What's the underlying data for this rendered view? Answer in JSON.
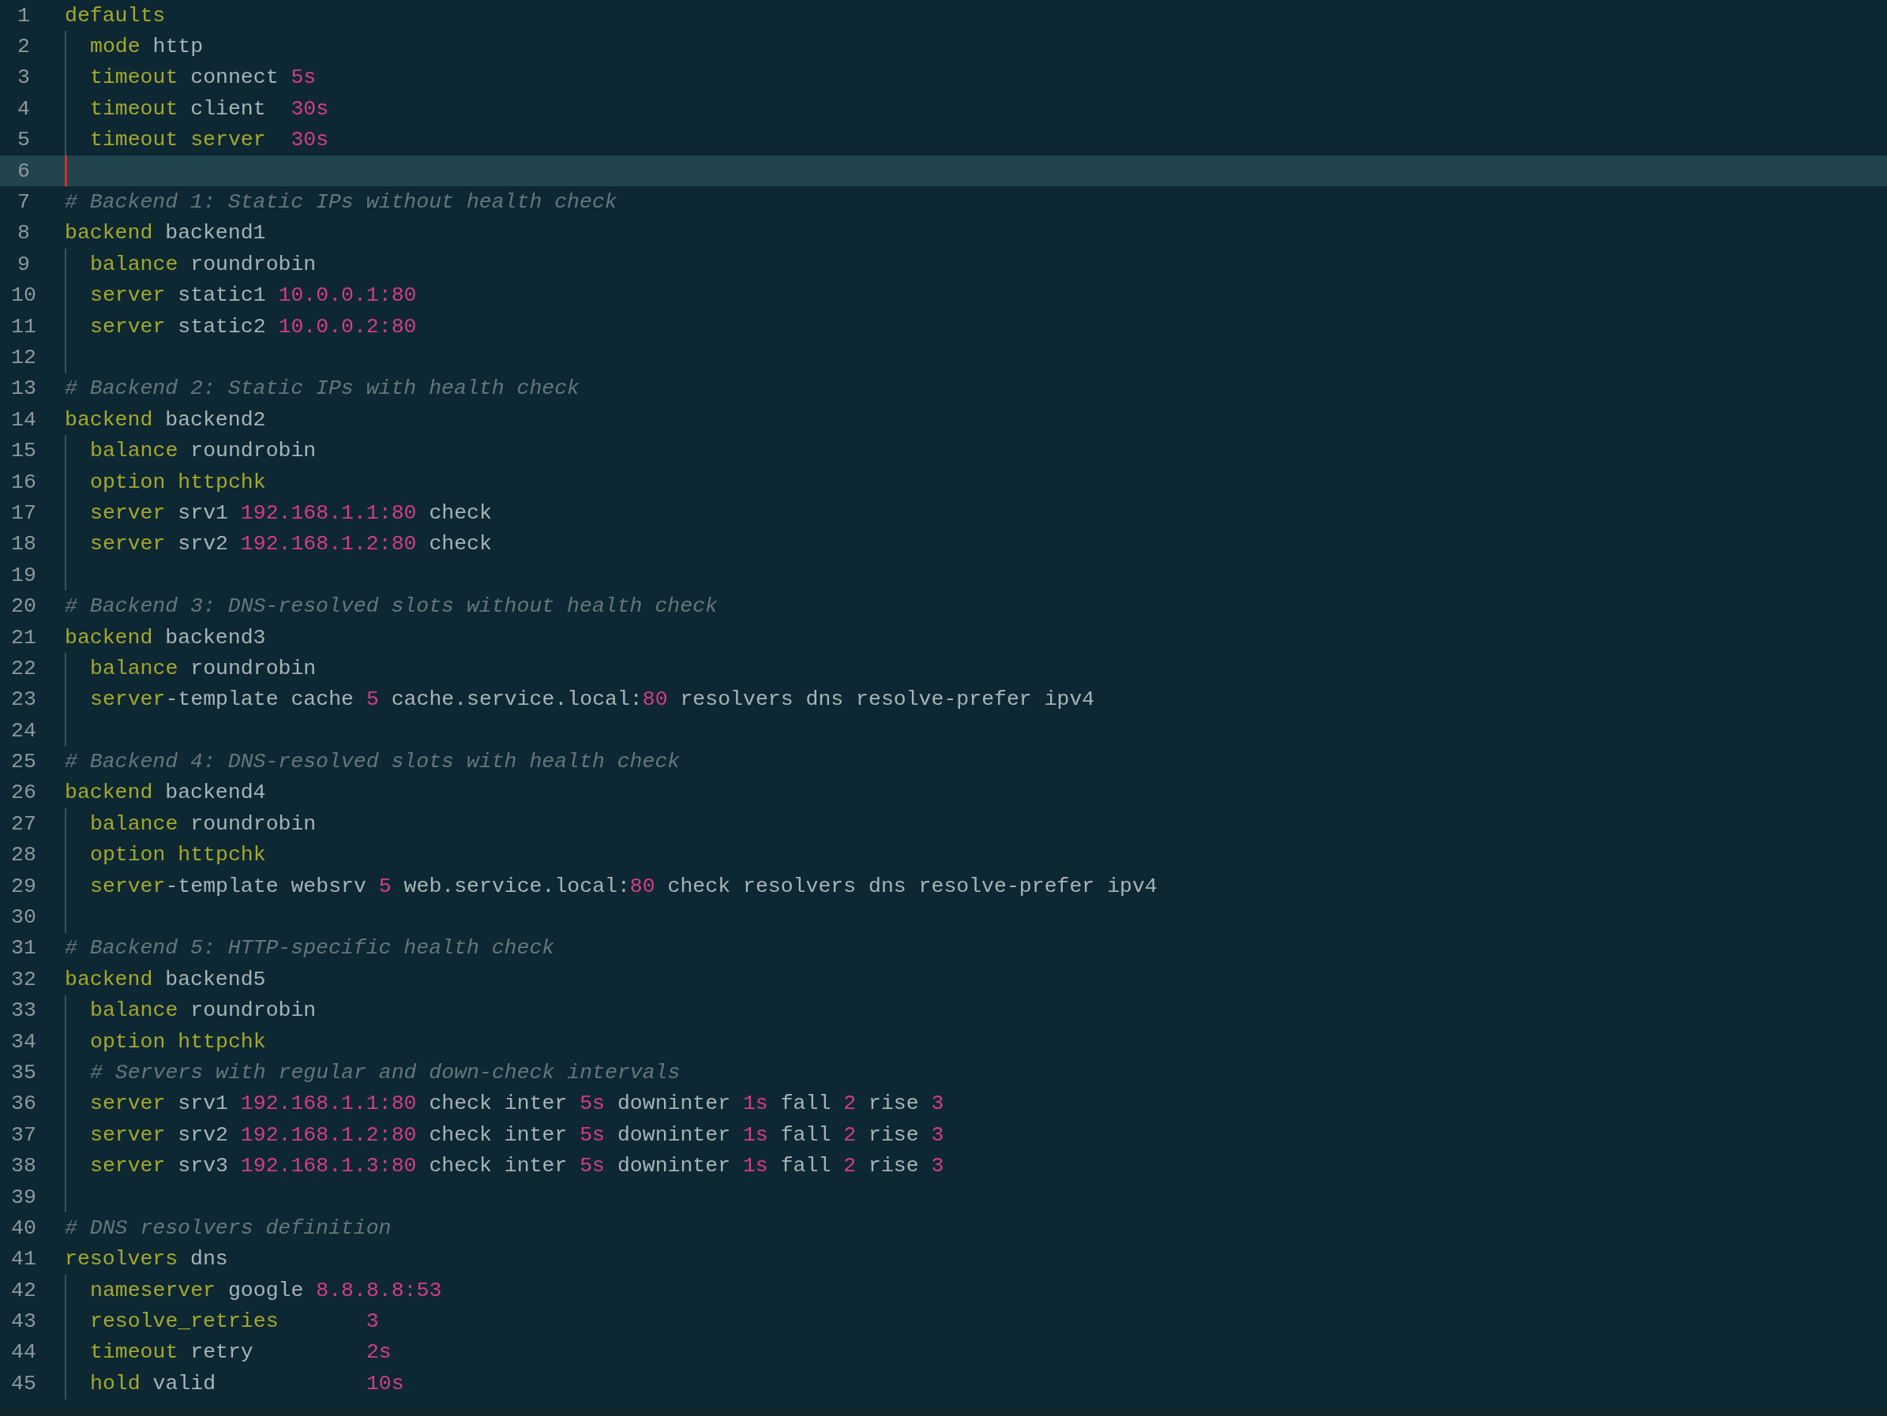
{
  "editor": {
    "lines": [
      {
        "number": "1",
        "indented": false,
        "current": false,
        "tokens": [
          {
            "text": "defaults",
            "kind": "keyword"
          }
        ]
      },
      {
        "number": "2",
        "indented": true,
        "current": false,
        "tokens": [
          {
            "text": "mode",
            "kind": "keyword"
          },
          {
            "text": " http",
            "kind": "plain"
          }
        ]
      },
      {
        "number": "3",
        "indented": true,
        "current": false,
        "tokens": [
          {
            "text": "timeout",
            "kind": "keyword"
          },
          {
            "text": " connect ",
            "kind": "plain"
          },
          {
            "text": "5s",
            "kind": "number"
          }
        ]
      },
      {
        "number": "4",
        "indented": true,
        "current": false,
        "tokens": [
          {
            "text": "timeout",
            "kind": "keyword"
          },
          {
            "text": " client  ",
            "kind": "plain"
          },
          {
            "text": "30s",
            "kind": "number"
          }
        ]
      },
      {
        "number": "5",
        "indented": true,
        "current": false,
        "tokens": [
          {
            "text": "timeout server  ",
            "kind": "keyword"
          },
          {
            "text": "30s",
            "kind": "number"
          }
        ]
      },
      {
        "number": "6",
        "indented": true,
        "current": true
      },
      {
        "number": "7",
        "indented": false,
        "current": false,
        "tokens": [
          {
            "text": "# Backend 1: Static IPs without health check",
            "kind": "comment"
          }
        ]
      },
      {
        "number": "8",
        "indented": false,
        "current": false,
        "tokens": [
          {
            "text": "backend",
            "kind": "keyword"
          },
          {
            "text": " backend1",
            "kind": "plain"
          }
        ]
      },
      {
        "number": "9",
        "indented": true,
        "current": false,
        "tokens": [
          {
            "text": "balance",
            "kind": "keyword"
          },
          {
            "text": " roundrobin",
            "kind": "plain"
          }
        ]
      },
      {
        "number": "10",
        "indented": true,
        "current": false,
        "tokens": [
          {
            "text": "server",
            "kind": "keyword"
          },
          {
            "text": " static1 ",
            "kind": "plain"
          },
          {
            "text": "10.0.0.1:80",
            "kind": "number"
          }
        ]
      },
      {
        "number": "11",
        "indented": true,
        "current": false,
        "tokens": [
          {
            "text": "server",
            "kind": "keyword"
          },
          {
            "text": " static2 ",
            "kind": "plain"
          },
          {
            "text": "10.0.0.2:80",
            "kind": "number"
          }
        ]
      },
      {
        "number": "12",
        "indented": true,
        "current": false
      },
      {
        "number": "13",
        "indented": false,
        "current": false,
        "tokens": [
          {
            "text": "# Backend 2: Static IPs with health check",
            "kind": "comment"
          }
        ]
      },
      {
        "number": "14",
        "indented": false,
        "current": false,
        "tokens": [
          {
            "text": "backend",
            "kind": "keyword"
          },
          {
            "text": " backend2",
            "kind": "plain"
          }
        ]
      },
      {
        "number": "15",
        "indented": true,
        "current": false,
        "tokens": [
          {
            "text": "balance",
            "kind": "keyword"
          },
          {
            "text": " roundrobin",
            "kind": "plain"
          }
        ]
      },
      {
        "number": "16",
        "indented": true,
        "current": false,
        "tokens": [
          {
            "text": "option httpchk",
            "kind": "keyword"
          }
        ]
      },
      {
        "number": "17",
        "indented": true,
        "current": false,
        "tokens": [
          {
            "text": "server",
            "kind": "keyword"
          },
          {
            "text": " srv1 ",
            "kind": "plain"
          },
          {
            "text": "192.168.1.1:80",
            "kind": "number"
          },
          {
            "text": " check",
            "kind": "plain"
          }
        ]
      },
      {
        "number": "18",
        "indented": true,
        "current": false,
        "tokens": [
          {
            "text": "server",
            "kind": "keyword"
          },
          {
            "text": " srv2 ",
            "kind": "plain"
          },
          {
            "text": "192.168.1.2:80",
            "kind": "number"
          },
          {
            "text": " check",
            "kind": "plain"
          }
        ]
      },
      {
        "number": "19",
        "indented": true,
        "current": false
      },
      {
        "number": "20",
        "indented": false,
        "current": false,
        "tokens": [
          {
            "text": "# Backend 3: DNS-resolved slots without health check",
            "kind": "comment"
          }
        ]
      },
      {
        "number": "21",
        "indented": false,
        "current": false,
        "tokens": [
          {
            "text": "backend",
            "kind": "keyword"
          },
          {
            "text": " backend3",
            "kind": "plain"
          }
        ]
      },
      {
        "number": "22",
        "indented": true,
        "current": false,
        "tokens": [
          {
            "text": "balance",
            "kind": "keyword"
          },
          {
            "text": " roundrobin",
            "kind": "plain"
          }
        ]
      },
      {
        "number": "23",
        "indented": true,
        "current": false,
        "tokens": [
          {
            "text": "server",
            "kind": "keyword"
          },
          {
            "text": "-template cache ",
            "kind": "plain"
          },
          {
            "text": "5",
            "kind": "number"
          },
          {
            "text": " cache.service.local:",
            "kind": "plain"
          },
          {
            "text": "80",
            "kind": "number"
          },
          {
            "text": " resolvers dns resolve-prefer ipv4",
            "kind": "plain"
          }
        ]
      },
      {
        "number": "24",
        "indented": true,
        "current": false
      },
      {
        "number": "25",
        "indented": false,
        "current": false,
        "tokens": [
          {
            "text": "# Backend 4: DNS-resolved slots with health check",
            "kind": "comment"
          }
        ]
      },
      {
        "number": "26",
        "indented": false,
        "current": false,
        "tokens": [
          {
            "text": "backend",
            "kind": "keyword"
          },
          {
            "text": " backend4",
            "kind": "plain"
          }
        ]
      },
      {
        "number": "27",
        "indented": true,
        "current": false,
        "tokens": [
          {
            "text": "balance",
            "kind": "keyword"
          },
          {
            "text": " roundrobin",
            "kind": "plain"
          }
        ]
      },
      {
        "number": "28",
        "indented": true,
        "current": false,
        "tokens": [
          {
            "text": "option httpchk",
            "kind": "keyword"
          }
        ]
      },
      {
        "number": "29",
        "indented": true,
        "current": false,
        "tokens": [
          {
            "text": "server",
            "kind": "keyword"
          },
          {
            "text": "-template websrv ",
            "kind": "plain"
          },
          {
            "text": "5",
            "kind": "number"
          },
          {
            "text": " web.service.local:",
            "kind": "plain"
          },
          {
            "text": "80",
            "kind": "number"
          },
          {
            "text": " check resolvers dns resolve-prefer ipv4",
            "kind": "plain"
          }
        ]
      },
      {
        "number": "30",
        "indented": true,
        "current": false
      },
      {
        "number": "31",
        "indented": false,
        "current": false,
        "tokens": [
          {
            "text": "# Backend 5: HTTP-specific health check",
            "kind": "comment"
          }
        ]
      },
      {
        "number": "32",
        "indented": false,
        "current": false,
        "tokens": [
          {
            "text": "backend",
            "kind": "keyword"
          },
          {
            "text": " backend5",
            "kind": "plain"
          }
        ]
      },
      {
        "number": "33",
        "indented": true,
        "current": false,
        "tokens": [
          {
            "text": "balance",
            "kind": "keyword"
          },
          {
            "text": " roundrobin",
            "kind": "plain"
          }
        ]
      },
      {
        "number": "34",
        "indented": true,
        "current": false,
        "tokens": [
          {
            "text": "option httpchk",
            "kind": "keyword"
          }
        ]
      },
      {
        "number": "35",
        "indented": true,
        "current": false,
        "tokens": [
          {
            "text": "# Servers with regular and down-check intervals",
            "kind": "comment"
          }
        ]
      },
      {
        "number": "36",
        "indented": true,
        "current": false,
        "tokens": [
          {
            "text": "server",
            "kind": "keyword"
          },
          {
            "text": " srv1 ",
            "kind": "plain"
          },
          {
            "text": "192.168.1.1:80",
            "kind": "number"
          },
          {
            "text": " check inter ",
            "kind": "plain"
          },
          {
            "text": "5s",
            "kind": "number"
          },
          {
            "text": " downinter ",
            "kind": "plain"
          },
          {
            "text": "1s",
            "kind": "number"
          },
          {
            "text": " fall ",
            "kind": "plain"
          },
          {
            "text": "2",
            "kind": "number"
          },
          {
            "text": " rise ",
            "kind": "plain"
          },
          {
            "text": "3",
            "kind": "number"
          }
        ]
      },
      {
        "number": "37",
        "indented": true,
        "current": false,
        "tokens": [
          {
            "text": "server",
            "kind": "keyword"
          },
          {
            "text": " srv2 ",
            "kind": "plain"
          },
          {
            "text": "192.168.1.2:80",
            "kind": "number"
          },
          {
            "text": " check inter ",
            "kind": "plain"
          },
          {
            "text": "5s",
            "kind": "number"
          },
          {
            "text": " downinter ",
            "kind": "plain"
          },
          {
            "text": "1s",
            "kind": "number"
          },
          {
            "text": " fall ",
            "kind": "plain"
          },
          {
            "text": "2",
            "kind": "number"
          },
          {
            "text": " rise ",
            "kind": "plain"
          },
          {
            "text": "3",
            "kind": "number"
          }
        ]
      },
      {
        "number": "38",
        "indented": true,
        "current": false,
        "tokens": [
          {
            "text": "server",
            "kind": "keyword"
          },
          {
            "text": " srv3 ",
            "kind": "plain"
          },
          {
            "text": "192.168.1.3:80",
            "kind": "number"
          },
          {
            "text": " check inter ",
            "kind": "plain"
          },
          {
            "text": "5s",
            "kind": "number"
          },
          {
            "text": " downinter ",
            "kind": "plain"
          },
          {
            "text": "1s",
            "kind": "number"
          },
          {
            "text": " fall ",
            "kind": "plain"
          },
          {
            "text": "2",
            "kind": "number"
          },
          {
            "text": " rise ",
            "kind": "plain"
          },
          {
            "text": "3",
            "kind": "number"
          }
        ]
      },
      {
        "number": "39",
        "indented": true,
        "current": false
      },
      {
        "number": "40",
        "indented": false,
        "current": false,
        "tokens": [
          {
            "text": "# DNS resolvers definition",
            "kind": "comment"
          }
        ]
      },
      {
        "number": "41",
        "indented": false,
        "current": false,
        "tokens": [
          {
            "text": "resolvers",
            "kind": "keyword"
          },
          {
            "text": " dns",
            "kind": "plain"
          }
        ]
      },
      {
        "number": "42",
        "indented": true,
        "current": false,
        "tokens": [
          {
            "text": "nameserver",
            "kind": "keyword"
          },
          {
            "text": " google ",
            "kind": "plain"
          },
          {
            "text": "8.8.8.8:53",
            "kind": "number"
          }
        ]
      },
      {
        "number": "43",
        "indented": true,
        "current": false,
        "tokens": [
          {
            "text": "resolve_retries       ",
            "kind": "keyword"
          },
          {
            "text": "3",
            "kind": "number"
          }
        ]
      },
      {
        "number": "44",
        "indented": true,
        "current": false,
        "tokens": [
          {
            "text": "timeout",
            "kind": "keyword"
          },
          {
            "text": " retry         ",
            "kind": "plain"
          },
          {
            "text": "2s",
            "kind": "number"
          }
        ]
      },
      {
        "number": "45",
        "indented": true,
        "current": false,
        "tokens": [
          {
            "text": "hold",
            "kind": "keyword"
          },
          {
            "text": " valid            ",
            "kind": "plain"
          },
          {
            "text": "10s",
            "kind": "number"
          }
        ]
      }
    ]
  }
}
